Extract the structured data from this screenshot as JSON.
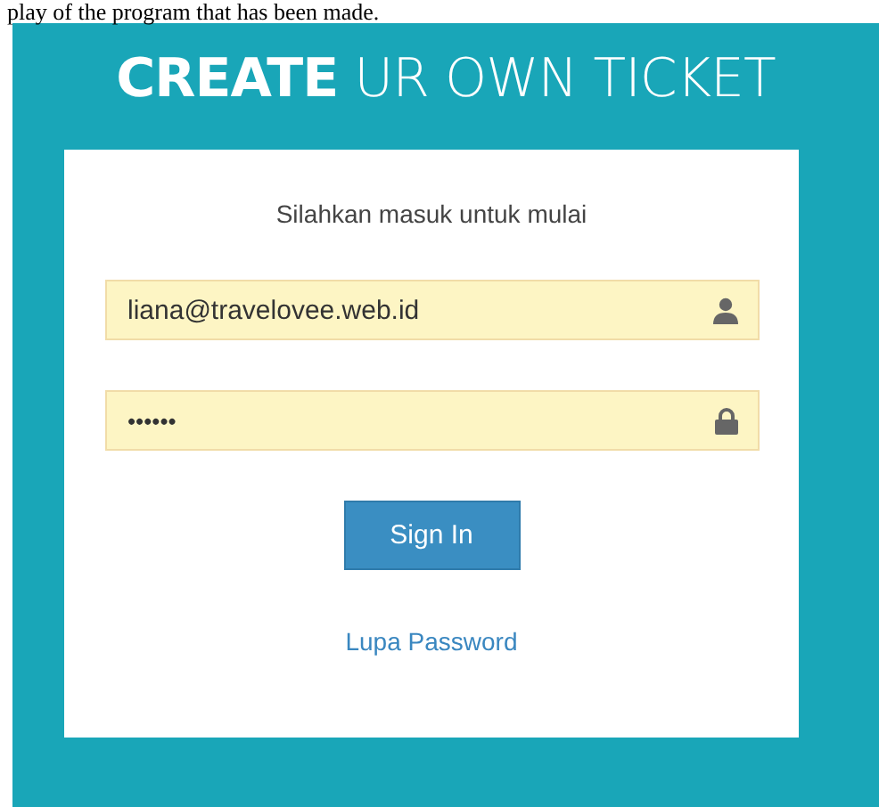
{
  "caption": "play of the program that has been made.",
  "header": {
    "title": "**CREATE** UR OWN TICKET"
  },
  "login": {
    "prompt": "Silahkan masuk untuk mulai",
    "fields": [
      {
        "kind": "email",
        "value": "liana@travelovee.web.id"
      },
      {
        "kind": "password",
        "value": "••••••"
      }
    ],
    "button": "Sign In",
    "link": "Lupa Password"
  }
}
